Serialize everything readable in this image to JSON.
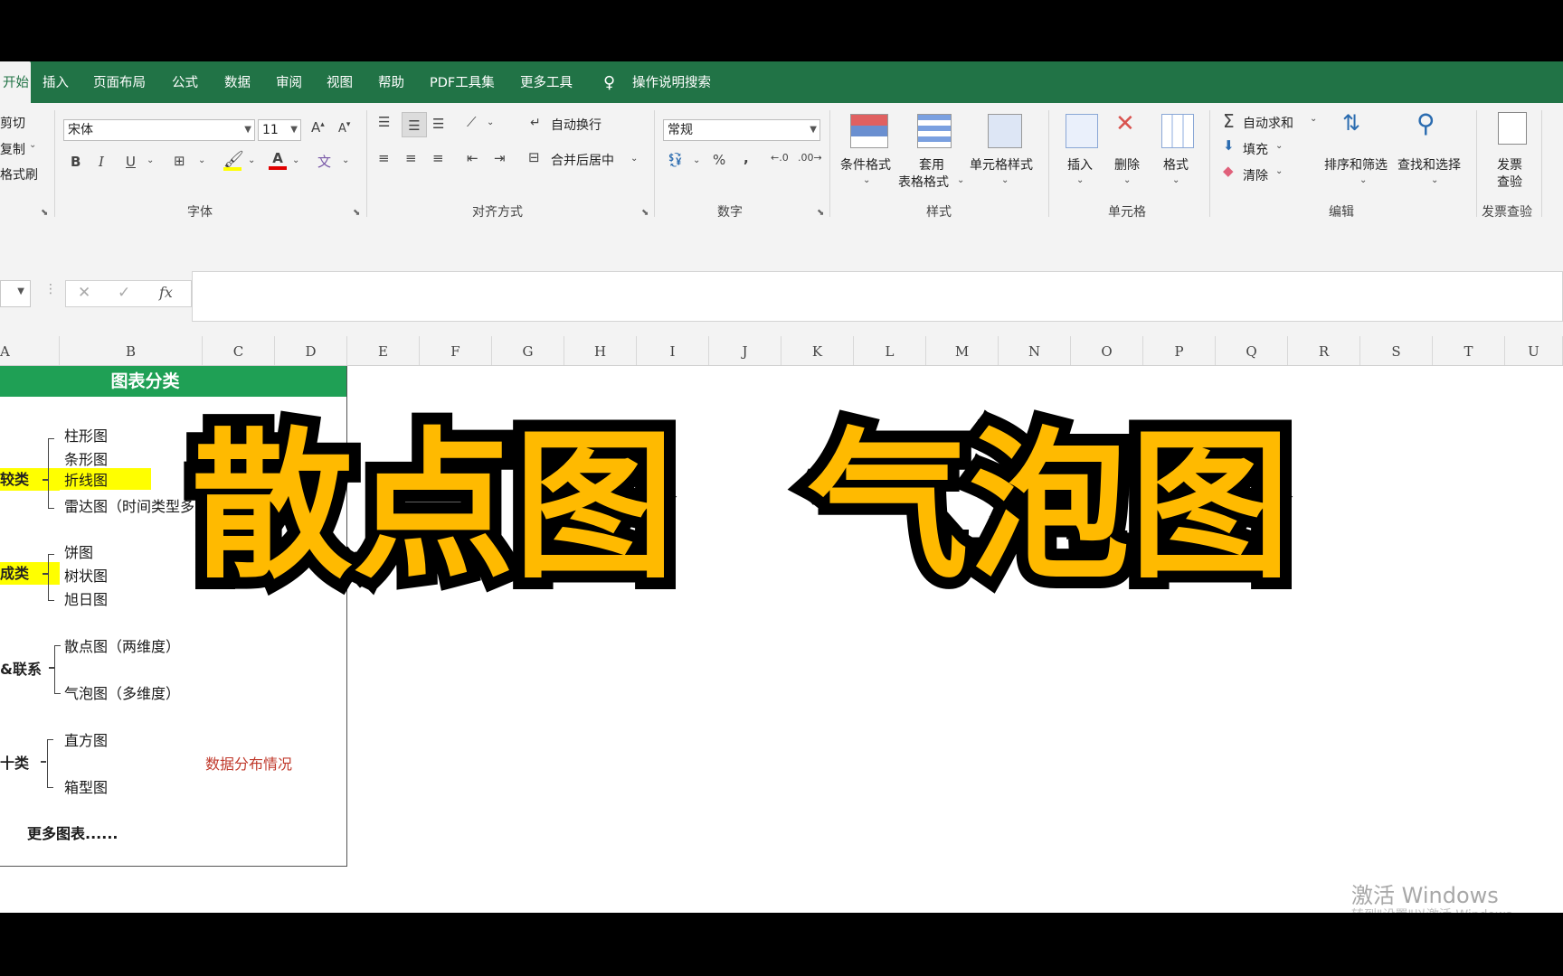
{
  "menu": {
    "tabs": [
      "开始",
      "插入",
      "页面布局",
      "公式",
      "数据",
      "审阅",
      "视图",
      "帮助",
      "PDF工具集",
      "更多工具"
    ],
    "search_label": "操作说明搜索"
  },
  "ribbon": {
    "clipboard": {
      "cut": "剪切",
      "copy": "复制",
      "format_painter": "格式刷"
    },
    "font": {
      "font_name": "宋体",
      "font_size": "11",
      "bold": "B",
      "italic": "I",
      "underline": "U",
      "grow": "A",
      "shrink": "A",
      "font_color": "A",
      "group_label": "字体"
    },
    "alignment": {
      "wrap_text": "自动换行",
      "merge_center": "合并后居中",
      "group_label": "对齐方式"
    },
    "number": {
      "format": "常规",
      "percent": "%",
      "comma": ",",
      "group_label": "数字"
    },
    "styles": {
      "conditional": "条件格式",
      "table_line1": "套用",
      "table_line2": "表格格式",
      "cell_styles": "单元格样式",
      "group_label": "样式"
    },
    "cells": {
      "insert": "插入",
      "delete": "删除",
      "format": "格式",
      "group_label": "单元格"
    },
    "editing": {
      "autosum": "自动求和",
      "fill": "填充",
      "clear": "清除",
      "sort": "排序和筛选",
      "find": "查找和选择",
      "group_label": "编辑"
    },
    "invoice": {
      "line1": "发票",
      "line2": "查验",
      "group_label": "发票查验"
    }
  },
  "formula_bar": {
    "fx": "fx",
    "cancel": "✕",
    "confirm": "✓",
    "value": ""
  },
  "columns": [
    "A",
    "B",
    "C",
    "D",
    "E",
    "F",
    "G",
    "H",
    "I",
    "J",
    "K",
    "L",
    "M",
    "N",
    "O",
    "P",
    "Q",
    "R",
    "S",
    "T",
    "U"
  ],
  "sheet": {
    "header": "图表分类",
    "groups": [
      {
        "label": "较类",
        "highlighted": true,
        "items": [
          "柱形图",
          "条形图",
          "折线图",
          "雷达图（时间类型多）"
        ]
      },
      {
        "label": "成类",
        "highlighted": true,
        "items": [
          "饼图",
          "树状图",
          "旭日图"
        ]
      },
      {
        "label": "&联系",
        "highlighted": false,
        "items": [
          "散点图（两维度）",
          "气泡图（多维度）"
        ]
      },
      {
        "label": "十类",
        "highlighted": false,
        "items": [
          "直方图",
          "箱型图"
        ]
      }
    ],
    "note": "数据分布情况",
    "more": "更多图表......"
  },
  "overlay": {
    "left": "散点图",
    "right": "气泡图"
  },
  "watermark": {
    "line1": "激活 Windows",
    "line2": "转到\"设置\"以激活 Windows。"
  },
  "colors": {
    "excel_green": "#217346",
    "header_green": "#1fa055",
    "highlight": "#ffff00",
    "title_yellow": "#ffba00",
    "note_red": "#c0392b"
  }
}
